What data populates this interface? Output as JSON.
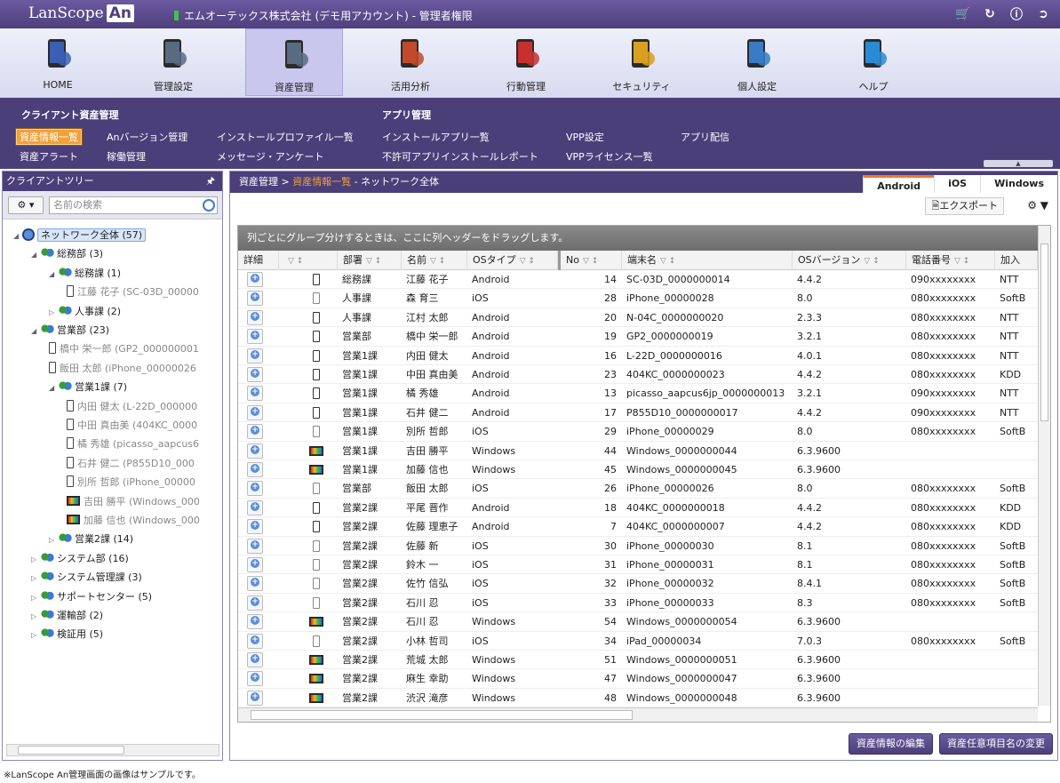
{
  "app": {
    "logo": "LanScope",
    "logo_an": "An",
    "company": "エムオーテックス株式会社 (デモ用アカウント) - 管理者権限"
  },
  "nav": [
    "HOME",
    "管理設定",
    "資産管理",
    "活用分析",
    "行動管理",
    "セキュリティ",
    "個人設定",
    "ヘルプ"
  ],
  "submenu": {
    "client_header": "クライアント資産管理",
    "app_header": "アプリ管理",
    "items": [
      "資産情報一覧",
      "Anバージョン管理",
      "インストールプロファイル一覧",
      "インストールアプリ一覧",
      "VPP設定",
      "アプリ配信",
      "資産アラート",
      "稼働管理",
      "メッセージ・アンケート",
      "不許可アプリインストールレポート",
      "VPPライセンス一覧"
    ]
  },
  "left": {
    "title": "クライアントツリー",
    "search_placeholder": "名前の検索"
  },
  "tree": [
    {
      "t": "ネットワーク全体 (57)",
      "lv": 0,
      "k": "root"
    },
    {
      "t": "総務部 (3)",
      "lv": 1,
      "k": "g"
    },
    {
      "t": "総務課 (1)",
      "lv": 2,
      "k": "g"
    },
    {
      "t": "江藤 花子 (SC-03D_00000",
      "lv": 3,
      "k": "d"
    },
    {
      "t": "人事課 (2)",
      "lv": 2,
      "k": "g"
    },
    {
      "t": "営業部 (23)",
      "lv": 1,
      "k": "g"
    },
    {
      "t": "橋中 栄一郎 (GP2_000000001",
      "lv": 2,
      "k": "d"
    },
    {
      "t": "飯田 太郎 (iPhone_00000026",
      "lv": 2,
      "k": "d"
    },
    {
      "t": "営業1課 (7)",
      "lv": 2,
      "k": "g"
    },
    {
      "t": "内田 健太 (L-22D_000000",
      "lv": 3,
      "k": "d"
    },
    {
      "t": "中田 真由美 (404KC_0000",
      "lv": 3,
      "k": "d"
    },
    {
      "t": "橘 秀雄 (picasso_aapcus6",
      "lv": 3,
      "k": "d"
    },
    {
      "t": "石井 健二 (P855D10_000",
      "lv": 3,
      "k": "d"
    },
    {
      "t": "別所 哲郎 (iPhone_00000",
      "lv": 3,
      "k": "d"
    },
    {
      "t": "吉田 勝平 (Windows_000",
      "lv": 3,
      "k": "p"
    },
    {
      "t": "加藤 信也 (Windows_000",
      "lv": 3,
      "k": "p"
    },
    {
      "t": "営業2課 (14)",
      "lv": 2,
      "k": "g"
    },
    {
      "t": "システム部 (16)",
      "lv": 1,
      "k": "g"
    },
    {
      "t": "システム管理課 (3)",
      "lv": 1,
      "k": "g"
    },
    {
      "t": "サポートセンター (5)",
      "lv": 1,
      "k": "g"
    },
    {
      "t": "運輸部 (2)",
      "lv": 1,
      "k": "g"
    },
    {
      "t": "検証用 (5)",
      "lv": 1,
      "k": "g"
    }
  ],
  "breadcrumb": {
    "root": "資産管理",
    "sep": ">",
    "current": "資産情報一覧",
    "scope": " - ネットワーク全体"
  },
  "os_tabs": [
    "Android",
    "iOS",
    "Windows"
  ],
  "export_label": "エクスポート",
  "group_hint": "列ごとにグループ分けするときは、ここに列ヘッダーをドラッグします。",
  "columns": [
    "詳細",
    "",
    "部署",
    "名前",
    "OSタイプ",
    "No",
    "端末名",
    "OSバージョン",
    "電話番号",
    "加入"
  ],
  "rows": [
    [
      "総務課",
      "江藤 花子",
      "Android",
      "14",
      "SC-03D_0000000014",
      "4.4.2",
      "090xxxxxxxx",
      "NTT"
    ],
    [
      "人事課",
      "森 育三",
      "iOS",
      "28",
      "iPhone_00000028",
      "8.0",
      "080xxxxxxxx",
      "SoftB"
    ],
    [
      "人事課",
      "江村 太郎",
      "Android",
      "20",
      "N-04C_0000000020",
      "2.3.3",
      "080xxxxxxxx",
      "NTT"
    ],
    [
      "営業部",
      "橋中 栄一郎",
      "Android",
      "19",
      "GP2_0000000019",
      "3.2.1",
      "080xxxxxxxx",
      "NTT"
    ],
    [
      "営業1課",
      "内田 健太",
      "Android",
      "16",
      "L-22D_0000000016",
      "4.0.1",
      "080xxxxxxxx",
      "NTT"
    ],
    [
      "営業1課",
      "中田 真由美",
      "Android",
      "23",
      "404KC_0000000023",
      "4.4.2",
      "080xxxxxxxx",
      "KDD"
    ],
    [
      "営業1課",
      "橘 秀雄",
      "Android",
      "13",
      "picasso_aapcus6jp_0000000013",
      "3.2.1",
      "090xxxxxxxx",
      "NTT"
    ],
    [
      "営業1課",
      "石井 健二",
      "Android",
      "17",
      "P855D10_0000000017",
      "4.4.2",
      "090xxxxxxxx",
      "NTT"
    ],
    [
      "営業1課",
      "別所 哲郎",
      "iOS",
      "29",
      "iPhone_00000029",
      "8.0",
      "080xxxxxxxx",
      "SoftB"
    ],
    [
      "営業1課",
      "吉田 勝平",
      "Windows",
      "44",
      "Windows_0000000044",
      "6.3.9600",
      "",
      ""
    ],
    [
      "営業1課",
      "加藤 信也",
      "Windows",
      "45",
      "Windows_0000000045",
      "6.3.9600",
      "",
      ""
    ],
    [
      "営業部",
      "飯田 太郎",
      "iOS",
      "26",
      "iPhone_00000026",
      "8.0",
      "080xxxxxxxx",
      "SoftB"
    ],
    [
      "営業2課",
      "平尾 晋作",
      "Android",
      "18",
      "404KC_0000000018",
      "4.4.2",
      "080xxxxxxxx",
      "KDD"
    ],
    [
      "営業2課",
      "佐藤 理恵子",
      "Android",
      "7",
      "404KC_0000000007",
      "4.4.2",
      "080xxxxxxxx",
      "KDD"
    ],
    [
      "営業2課",
      "佐藤 新",
      "iOS",
      "30",
      "iPhone_00000030",
      "8.1",
      "080xxxxxxxx",
      "SoftB"
    ],
    [
      "営業2課",
      "鈴木 一",
      "iOS",
      "31",
      "iPhone_00000031",
      "8.1",
      "080xxxxxxxx",
      "SoftB"
    ],
    [
      "営業2課",
      "佐竹 信弘",
      "iOS",
      "32",
      "iPhone_00000032",
      "8.4.1",
      "080xxxxxxxx",
      "SoftB"
    ],
    [
      "営業2課",
      "石川 忍",
      "iOS",
      "33",
      "iPhone_00000033",
      "8.3",
      "080xxxxxxxx",
      "SoftB"
    ],
    [
      "営業2課",
      "石川 忍",
      "Windows",
      "54",
      "Windows_0000000054",
      "6.3.9600",
      "",
      ""
    ],
    [
      "営業2課",
      "小林 哲司",
      "iOS",
      "34",
      "iPad_00000034",
      "7.0.3",
      "080xxxxxxxx",
      "SoftB"
    ],
    [
      "営業2課",
      "荒城 太郎",
      "Windows",
      "51",
      "Windows_0000000051",
      "6.3.9600",
      "",
      ""
    ],
    [
      "営業2課",
      "麻生 幸助",
      "Windows",
      "47",
      "Windows_0000000047",
      "6.3.9600",
      "",
      ""
    ],
    [
      "営業2課",
      "渋沢 滝彦",
      "Windows",
      "48",
      "Windows_0000000048",
      "6.3.9600",
      "",
      ""
    ]
  ],
  "buttons": {
    "edit": "資産情報の編集",
    "rename": "資産任意項目名の変更"
  },
  "footnote": "※LanScope An管理画面の画像はサンプルです。"
}
